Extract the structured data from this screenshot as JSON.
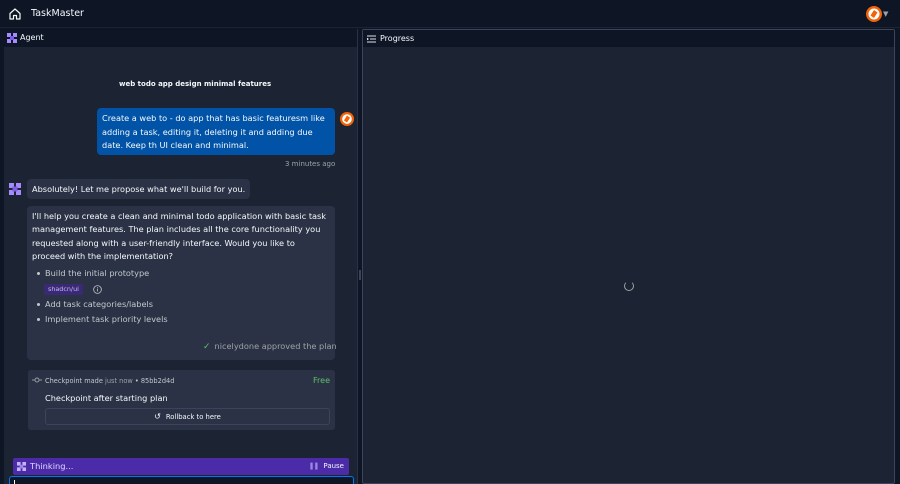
{
  "app": {
    "title": "TaskMaster",
    "accent_color": "#0079f2",
    "icons": [
      "home-icon",
      "avatar-icon",
      "chevron-down-icon"
    ]
  },
  "agent_pane": {
    "header_label": "Agent",
    "chat_title": "web todo app design minimal features",
    "user_message": "Create a web to - do app that has basic featuresm like adding a task, editing it, deleting it and adding due date. Keep th UI clean and minimal.",
    "user_message_time": "3 minutes ago",
    "agent_intro": "Absolutely! Let me propose what we'll build for you.",
    "plan": {
      "description": "I'll help you create a clean and minimal todo application with basic task management features. The plan includes all the core functionality you requested along with a user-friendly interface. Would you like to proceed with the implementation?",
      "items": [
        "Build the initial prototype",
        "Add task categories/labels",
        "Implement task priority levels"
      ],
      "tech_tag": "shadcn/ui",
      "approval": "nicelydone approved the plan"
    },
    "checkpoint": {
      "made_label": "Checkpoint made",
      "when": "just now",
      "separator": "•",
      "commit": "85bb2d4d",
      "price": "Free",
      "description": "Checkpoint after starting plan",
      "rollback_label": "Rollback to here"
    },
    "status": {
      "thinking_label": "Thinking...",
      "pause_label": "Pause"
    }
  },
  "progress_pane": {
    "header_label": "Progress"
  }
}
